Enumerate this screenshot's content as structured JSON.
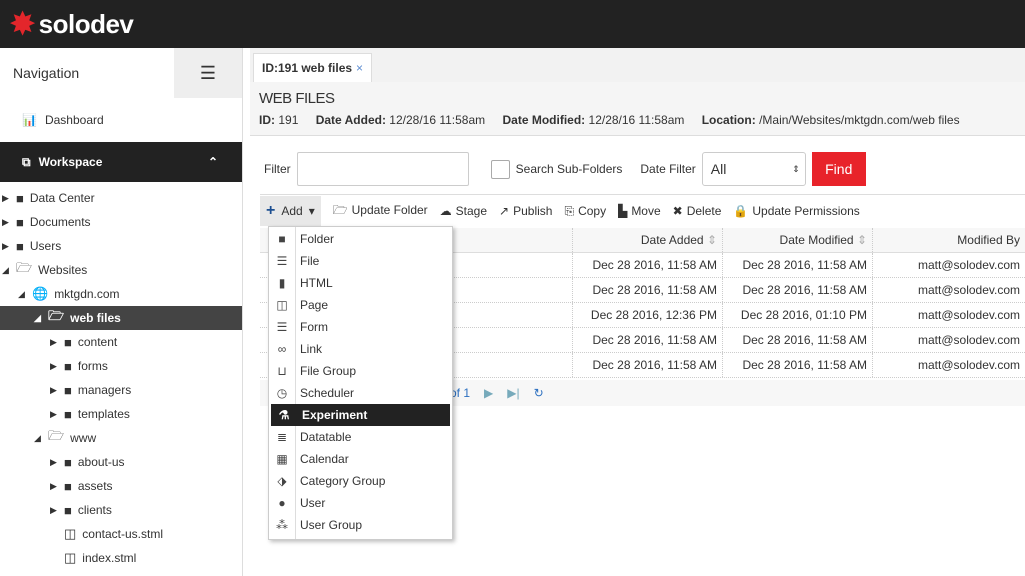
{
  "brand": "solodev",
  "nav": {
    "title": "Navigation",
    "dashboard": "Dashboard",
    "workspace": "Workspace",
    "tree": [
      {
        "label": "Data Center",
        "level": 0,
        "type": "folder",
        "state": "collapsed"
      },
      {
        "label": "Documents",
        "level": 0,
        "type": "folder",
        "state": "collapsed"
      },
      {
        "label": "Users",
        "level": 0,
        "type": "folder",
        "state": "collapsed"
      },
      {
        "label": "Websites",
        "level": 0,
        "type": "folder",
        "state": "expanded"
      },
      {
        "label": "mktgdn.com",
        "level": 1,
        "type": "globe",
        "state": "expanded"
      },
      {
        "label": "web files",
        "level": 2,
        "type": "folder",
        "state": "expanded",
        "selected": true
      },
      {
        "label": "content",
        "level": 3,
        "type": "folder",
        "state": "collapsed"
      },
      {
        "label": "forms",
        "level": 3,
        "type": "folder",
        "state": "collapsed"
      },
      {
        "label": "managers",
        "level": 3,
        "type": "folder",
        "state": "collapsed"
      },
      {
        "label": "templates",
        "level": 3,
        "type": "folder",
        "state": "collapsed"
      },
      {
        "label": "www",
        "level": 2,
        "type": "folder",
        "state": "expanded"
      },
      {
        "label": "about-us",
        "level": 3,
        "type": "folder",
        "state": "collapsed"
      },
      {
        "label": "assets",
        "level": 3,
        "type": "folder",
        "state": "collapsed"
      },
      {
        "label": "clients",
        "level": 3,
        "type": "folder",
        "state": "collapsed"
      },
      {
        "label": "contact-us.stml",
        "level": 3,
        "type": "page",
        "state": "leaf"
      },
      {
        "label": "index.stml",
        "level": 3,
        "type": "page",
        "state": "leaf"
      }
    ]
  },
  "tab": {
    "label": "ID:191 web files",
    "close": "×"
  },
  "header": {
    "title": "WEB FILES",
    "id_label": "ID:",
    "id": "191",
    "added_label": "Date Added:",
    "added": "12/28/16 11:58am",
    "modified_label": "Date Modified:",
    "modified": "12/28/16 11:58am",
    "location_label": "Location:",
    "location": "/Main/Websites/mktgdn.com/web files"
  },
  "filter": {
    "label": "Filter",
    "value": "",
    "subfolders": "Search Sub-Folders",
    "date_label": "Date Filter",
    "date_value": "All",
    "find": "Find"
  },
  "toolbar": [
    "Add",
    "Update Folder",
    "Stage",
    "Publish",
    "Copy",
    "Move",
    "Delete",
    "Update Permissions"
  ],
  "grid": {
    "headers": [
      "",
      "Date Added",
      "Date Modified",
      "Modified By"
    ],
    "rows": [
      [
        "Dec 28 2016, 11:58 AM",
        "Dec 28 2016, 11:58 AM",
        "matt@solodev.com"
      ],
      [
        "Dec 28 2016, 11:58 AM",
        "Dec 28 2016, 11:58 AM",
        "matt@solodev.com"
      ],
      [
        "Dec 28 2016, 12:36 PM",
        "Dec 28 2016, 01:10 PM",
        "matt@solodev.com"
      ],
      [
        "Dec 28 2016, 11:58 AM",
        "Dec 28 2016, 11:58 AM",
        "matt@solodev.com"
      ],
      [
        "Dec 28 2016, 11:58 AM",
        "Dec 28 2016, 11:58 AM",
        "matt@solodev.com"
      ]
    ]
  },
  "pager": {
    "text": "of 1"
  },
  "menu": [
    {
      "label": "Folder",
      "icon": "folder-icon",
      "glyph": "■"
    },
    {
      "label": "File",
      "icon": "file-icon",
      "glyph": "☰"
    },
    {
      "label": "HTML",
      "icon": "html-icon",
      "glyph": "▮"
    },
    {
      "label": "Page",
      "icon": "page-icon",
      "glyph": "◫"
    },
    {
      "label": "Form",
      "icon": "form-icon",
      "glyph": "☰"
    },
    {
      "label": "Link",
      "icon": "link-icon",
      "glyph": "∞"
    },
    {
      "label": "File Group",
      "icon": "inbox-icon",
      "glyph": "⊔"
    },
    {
      "label": "Scheduler",
      "icon": "clock-icon",
      "glyph": "◷"
    },
    {
      "label": "Experiment",
      "icon": "flask-icon",
      "glyph": "⚗",
      "active": true
    },
    {
      "label": "Datatable",
      "icon": "database-icon",
      "glyph": "≣"
    },
    {
      "label": "Calendar",
      "icon": "calendar-icon",
      "glyph": "▦"
    },
    {
      "label": "Category Group",
      "icon": "tags-icon",
      "glyph": "⬗"
    },
    {
      "label": "User",
      "icon": "user-icon",
      "glyph": "●"
    },
    {
      "label": "User Group",
      "icon": "users-icon",
      "glyph": "⁂"
    }
  ]
}
